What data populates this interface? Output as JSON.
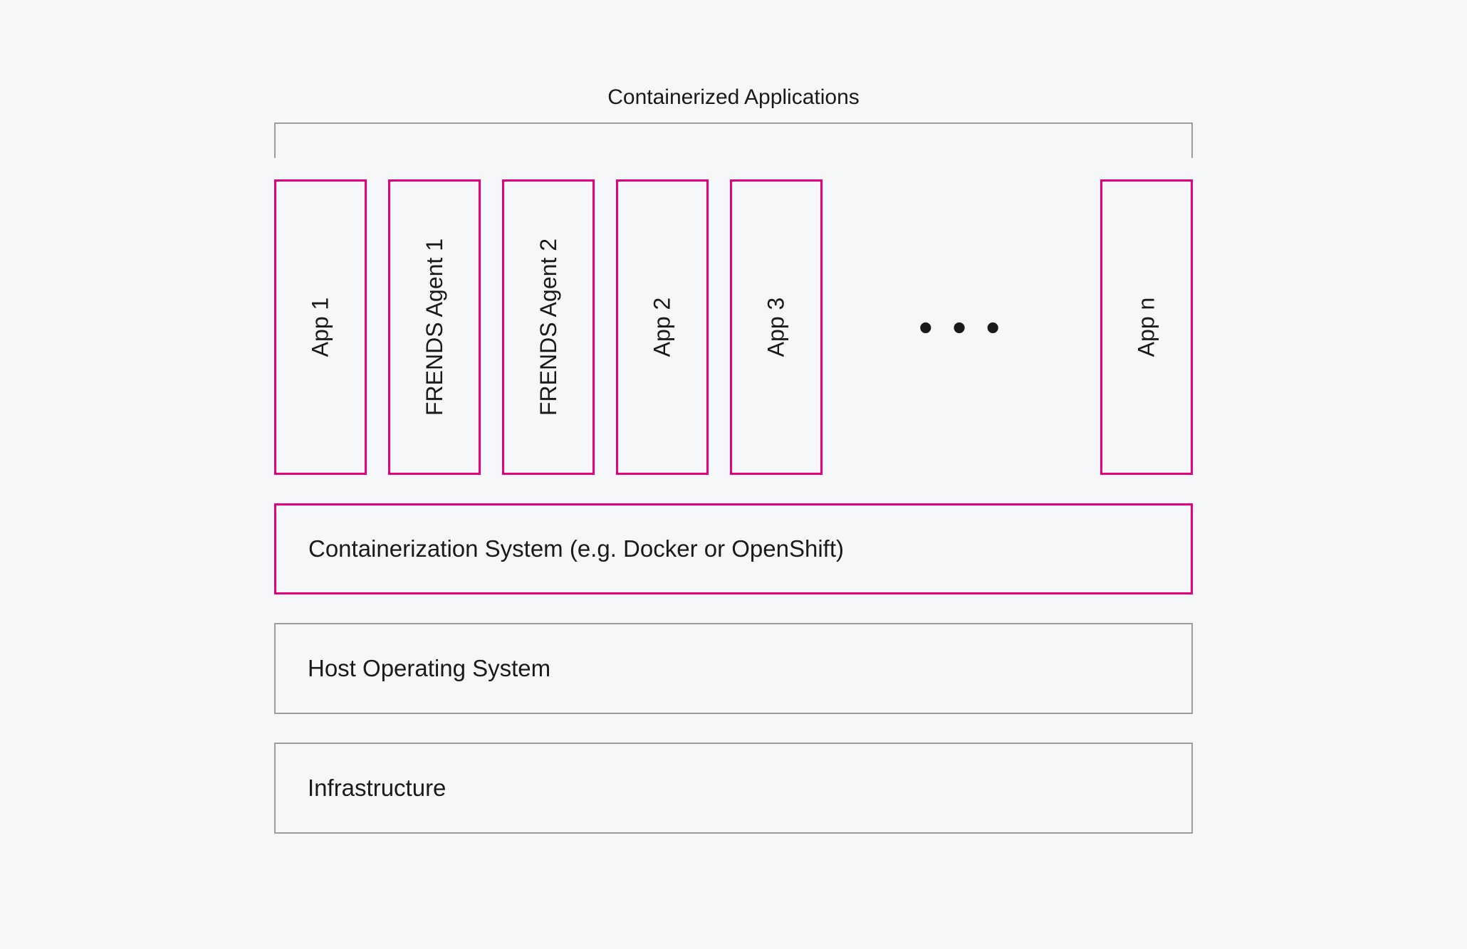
{
  "title": "Containerized Applications",
  "apps": {
    "app1": "App 1",
    "agent1": "FRENDS Agent 1",
    "agent2": "FRENDS Agent 2",
    "app2": "App 2",
    "app3": "App 3",
    "ellipsis": "• • •",
    "appn": "App n"
  },
  "layers": {
    "containerization": "Containerization System (e.g. Docker or OpenShift)",
    "host_os": "Host Operating System",
    "infrastructure": "Infrastructure"
  },
  "colors": {
    "accent": "#e6007e",
    "border_gray": "#9e9e9e",
    "background": "#f6f7f8",
    "text": "#1a1a1a"
  }
}
